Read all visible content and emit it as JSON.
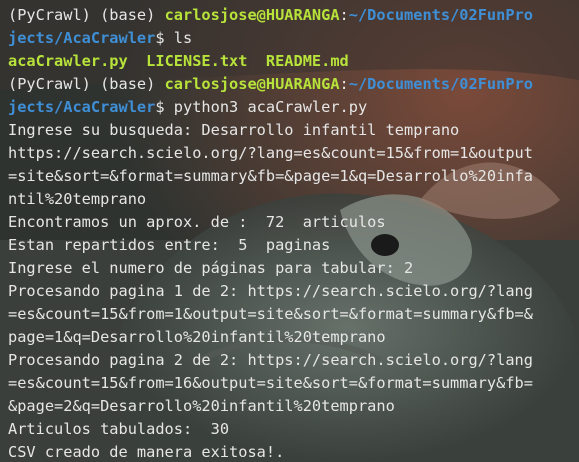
{
  "terminal": {
    "lines": [
      [
        {
          "t": "(PyCrawl) (base) ",
          "c": "plain"
        },
        {
          "t": "carlosjose@HUARANGA",
          "c": "user"
        },
        {
          "t": ":",
          "c": "plain"
        },
        {
          "t": "~/Documents/02FunPro",
          "c": "path"
        }
      ],
      [
        {
          "t": "jects/AcaCrawler",
          "c": "path"
        },
        {
          "t": "$ ls",
          "c": "plain"
        }
      ],
      [
        {
          "t": "acaCrawler.py",
          "c": "exec"
        },
        {
          "t": "  LICENSE.txt  README.md",
          "c": "exec"
        }
      ],
      [
        {
          "t": "(PyCrawl) (base) ",
          "c": "plain"
        },
        {
          "t": "carlosjose@HUARANGA",
          "c": "user"
        },
        {
          "t": ":",
          "c": "plain"
        },
        {
          "t": "~/Documents/02FunPro",
          "c": "path"
        }
      ],
      [
        {
          "t": "jects/AcaCrawler",
          "c": "path"
        },
        {
          "t": "$ python3 acaCrawler.py",
          "c": "plain"
        }
      ],
      [
        {
          "t": "Ingrese su busqueda: Desarrollo infantil temprano",
          "c": "plain"
        }
      ],
      [
        {
          "t": "https://search.scielo.org/?lang=es&count=15&from=1&output",
          "c": "plain"
        }
      ],
      [
        {
          "t": "=site&sort=&format=summary&fb=&page=1&q=Desarrollo%20infa",
          "c": "plain"
        }
      ],
      [
        {
          "t": "ntil%20temprano",
          "c": "plain"
        }
      ],
      [
        {
          "t": "Encontramos un aprox. de :  72  articulos",
          "c": "plain"
        }
      ],
      [
        {
          "t": "Estan repartidos entre:  5  paginas",
          "c": "plain"
        }
      ],
      [
        {
          "t": "Ingrese el numero de páginas para tabular: 2",
          "c": "plain"
        }
      ],
      [
        {
          "t": "Procesando pagina 1 de 2: https://search.scielo.org/?lang",
          "c": "plain"
        }
      ],
      [
        {
          "t": "=es&count=15&from=1&output=site&sort=&format=summary&fb=&",
          "c": "plain"
        }
      ],
      [
        {
          "t": "page=1&q=Desarrollo%20infantil%20temprano",
          "c": "plain"
        }
      ],
      [
        {
          "t": "Procesando pagina 2 de 2: https://search.scielo.org/?lang",
          "c": "plain"
        }
      ],
      [
        {
          "t": "=es&count=15&from=16&output=site&sort=&format=summary&fb=",
          "c": "plain"
        }
      ],
      [
        {
          "t": "&page=2&q=Desarrollo%20infantil%20temprano",
          "c": "plain"
        }
      ],
      [
        {
          "t": "Articulos tabulados:  30",
          "c": "plain"
        }
      ],
      [
        {
          "t": "CSV creado de manera exitosa!.",
          "c": "plain"
        }
      ]
    ]
  },
  "colors": {
    "user": "#b7e33a",
    "path": "#3f8fd6",
    "text": "#e6e6e6",
    "background": "#2b2e2a"
  }
}
